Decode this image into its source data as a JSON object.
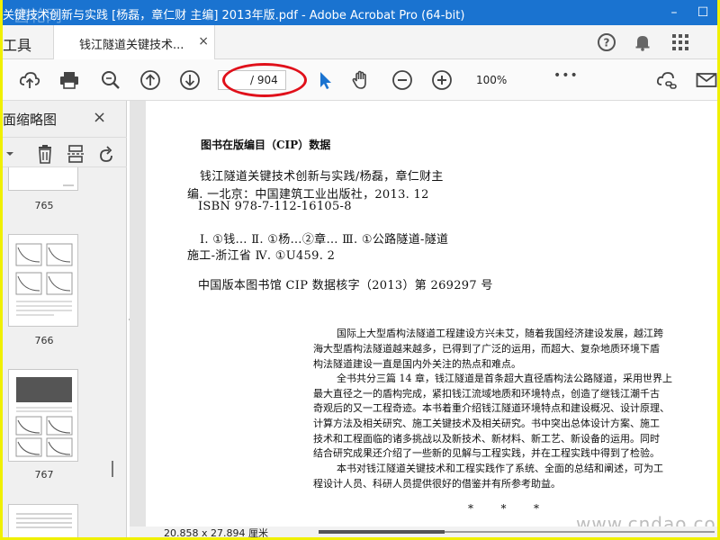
{
  "window": {
    "title": "关键技术创新与实践 [杨磊，章仁财 主编] 2013年版.pdf - Adobe Acrobat Pro (64-bit)",
    "watermark": "齿轮网",
    "minimize": "–",
    "maximize": "☐"
  },
  "tabs": {
    "tools_label": "工具",
    "document_label": "钱江隧道关键技术...",
    "close": "×"
  },
  "toolbar": {
    "page_current": "",
    "page_total": "/ 904",
    "zoom": "100%",
    "more": "•••"
  },
  "panel": {
    "title": "面缩略图",
    "close": "×",
    "thumbnails": [
      {
        "label": "765"
      },
      {
        "label": "766"
      },
      {
        "label": "767"
      }
    ]
  },
  "document": {
    "cip_title": "图书在版编目（CIP）数据",
    "cip_lines": [
      "钱江隧道关键技术创新与实践/杨磊，章仁财主",
      "编. 一北京：中国建筑工业出版社，2013. 12",
      "ISBN 978-7-112-16105-8",
      "Ⅰ. ①钱…    Ⅱ. ①杨…②章…    Ⅲ. ①公路隧道-隧道",
      "施工-浙江省   Ⅳ. ①U459. 2",
      "中国版本图书馆 CIP 数据核字（2013）第 269297 号"
    ],
    "body_lines": [
      "国际上大型盾构法隧道工程建设方兴未艾，随着我国经济建设发展，越江跨",
      "海大型盾构法隧道越来越多，已得到了广泛的运用，而超大、复杂地质环境下盾",
      "构法隧道建设一直是国内外关注的热点和难点。",
      "全书共分三篇 14 章，钱江隧道是首条超大直径盾构法公路隧道，采用世界上",
      "最大直径之一的盾构完成，紧扣钱江流域地质和环境特点，创造了继钱江潮千古",
      "奇观后的又一工程奇迹。本书着重介绍钱江隧道环境特点和建设概况、设计原理、",
      "计算方法及相关研究、施工关键技术及相关研究。书中突出总体设计方案、施工",
      "技术和工程面临的诸多挑战以及新技术、新材料、新工艺、新设备的运用。同时",
      "结合研究成果还介绍了一些新的见解与工程实践，并在工程实践中得到了检验。",
      "本书对钱江隧道关键技术和工程实践作了系统、全面的总结和阐述，可为工",
      "程设计人员、科研人员提供很好的借鉴并有所参考助益。"
    ],
    "stars": "*        *        *",
    "site_watermark": "www.cndao.com"
  },
  "status": {
    "page_size": "20.858 x 27.894 厘米"
  },
  "colors": {
    "titlebar": "#1a73d0",
    "highlight_ellipse": "#e0101a",
    "select_tool": "#1a73d0",
    "frame": "#f0f000"
  }
}
